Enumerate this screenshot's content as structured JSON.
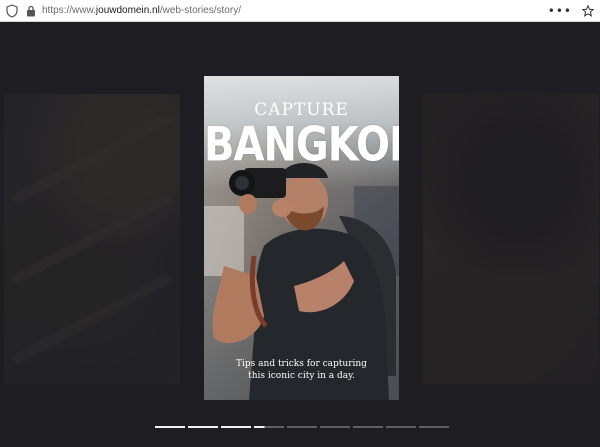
{
  "browser": {
    "url_prefix": "https://www.",
    "url_host": "jouwdomein.nl",
    "url_path": "/web-stories/story/",
    "menu_glyph": "•••",
    "icons": [
      "shield-icon",
      "lock-icon",
      "menu-dots-icon",
      "bookmark-star-icon"
    ]
  },
  "story": {
    "kicker": "CAPTURE",
    "headline": "BANGKOK",
    "caption_line1": "Tips and tricks for capturing",
    "caption_line2": "this iconic city in a day."
  },
  "progress": {
    "segments": [
      "done",
      "done",
      "done",
      "active",
      "pending",
      "pending",
      "pending",
      "pending",
      "pending"
    ]
  },
  "colors": {
    "background": "#1d1d22",
    "progress_done": "#f2f2f2",
    "progress_pending": "#5f5f66",
    "headline_text": "#ffffff"
  }
}
